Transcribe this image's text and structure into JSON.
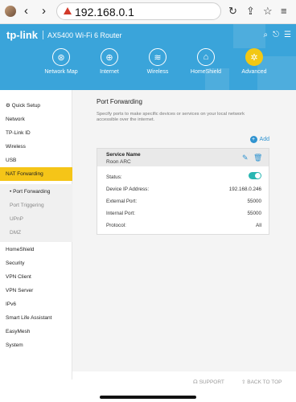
{
  "browser": {
    "url": "192.168.0.1",
    "back_glyph": "‹",
    "forward_glyph": "›",
    "reload_glyph": "↻",
    "share_glyph": "⇪",
    "bookmark_glyph": "☆",
    "menu_glyph": "≡"
  },
  "header": {
    "brand": "tp-link",
    "model": "AX5400 Wi-Fi 6 Router",
    "icons": [
      "search-icon",
      "logout-icon",
      "user-icon"
    ]
  },
  "tabs": [
    {
      "label": "Network Map",
      "icon": "network-map-icon",
      "glyph": "⊛"
    },
    {
      "label": "Internet",
      "icon": "globe-icon",
      "glyph": "⊕"
    },
    {
      "label": "Wireless",
      "icon": "wifi-icon",
      "glyph": "≋"
    },
    {
      "label": "HomeShield",
      "icon": "shield-icon",
      "glyph": "⌂"
    },
    {
      "label": "Advanced",
      "icon": "gear-icon",
      "glyph": "✲",
      "active": true
    }
  ],
  "sidebar": {
    "items": [
      {
        "label": "Quick Setup",
        "icon": "gear-icon"
      },
      {
        "label": "Network"
      },
      {
        "label": "TP-Link ID"
      },
      {
        "label": "Wireless"
      },
      {
        "label": "USB"
      },
      {
        "label": "NAT Forwarding",
        "active": true
      },
      {
        "label": "Port Forwarding",
        "sub": true,
        "current": true
      },
      {
        "label": "Port Triggering",
        "sub": true
      },
      {
        "label": "UPnP",
        "sub": true
      },
      {
        "label": "DMZ",
        "sub": true
      },
      {
        "label": "HomeShield"
      },
      {
        "label": "Security"
      },
      {
        "label": "VPN Client"
      },
      {
        "label": "VPN Server"
      },
      {
        "label": "IPv6"
      },
      {
        "label": "Smart Life Assistant"
      },
      {
        "label": "EasyMesh"
      },
      {
        "label": "System"
      }
    ]
  },
  "main": {
    "title": "Port Forwarding",
    "description": "Specify ports to make specific devices or services on your local network accessible over the internet.",
    "add_label": "Add",
    "card": {
      "header_label": "Service Name",
      "service_name": "Roon ARC",
      "rows": [
        {
          "label": "Status:",
          "toggle": true,
          "enabled": true
        },
        {
          "label": "Device IP Address:",
          "value": "192.168.0.246"
        },
        {
          "label": "External Port:",
          "value": "55000"
        },
        {
          "label": "Internal Port:",
          "value": "55000"
        },
        {
          "label": "Protocol:",
          "value": "All"
        }
      ]
    }
  },
  "footer": {
    "support": "SUPPORT",
    "back_to_top": "BACK TO TOP"
  },
  "colors": {
    "header_blue": "#3aa4da",
    "accent_yellow": "#f5c518",
    "link_blue": "#2f93d0",
    "toggle_teal": "#29b6b2"
  }
}
